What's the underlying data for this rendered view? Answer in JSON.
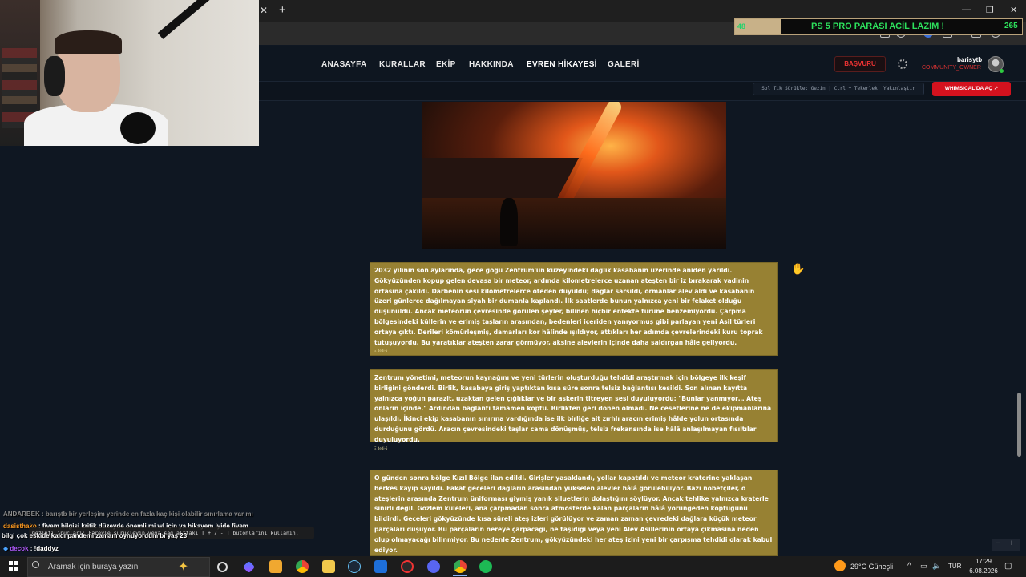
{
  "browser": {
    "tab_close": "✕",
    "tab_new": "+",
    "window_controls": [
      "—",
      "❐",
      "✕"
    ]
  },
  "donation_goal": {
    "current": "48",
    "title": "PS 5 PRO PARASI ACİL LAZIM !",
    "target": "265"
  },
  "nav": {
    "links": [
      "ANASAYFA",
      "KURALLAR",
      "EKİP",
      "HAKKINDA",
      "EVREN HİKAYESİ",
      "GALERİ"
    ],
    "apply_button": "BAŞVURU",
    "user_name": "barisytb",
    "user_role": "COMMUNITY_OWNER"
  },
  "toolbar": {
    "hint": "Sol Tık Sürükle: Gezin | Ctrl + Tekerlek: Yakınlaştır",
    "whimsical_button": "WHIMSICAL'DA AÇ"
  },
  "story": {
    "paragraph1": "2032 yılının son aylarında, gece göğü Zentrum'un kuzeyindeki dağlık kasabanın üzerinde aniden yarıldı. Gökyüzünden kopup gelen devasa bir meteor, ardında kilometrelerce uzanan ateşten bir iz bırakarak vadinin ortasına çakıldı. Darbenin sesi kilometrelerce öteden duyuldu; dağlar sarsıldı, ormanlar alev aldı ve kasabanın üzeri günlerce dağılmayan siyah bir dumanla kaplandı.  İlk saatlerde bunun yalnızca yeni bir felaket olduğu düşünüldü. Ancak meteorun çevresinde görülen şeyler, bilinen hiçbir enfekte türüne benzemiyordu. Çarpma bölgesindeki küllerin ve erimiş taşların arasından, bedenleri içeriden yanıyormuş gibi parlayan yeni Asil türleri ortaya çıktı. Derileri kömürleşmiş, damarları kor hâlinde ışıldıyor, attıkları her adımda çevrelerindeki kuru toprak tutuşuyordu. Bu yaratıklar ateşten zarar görmüyor, aksine alevlerin içinde daha saldırgan hâle geliyordu.",
    "paragraph2": "Zentrum yönetimi, meteorun kaynağını ve yeni türlerin oluşturduğu tehdidi araştırmak için bölgeye ilk keşif birliğini gönderdi. Birlik, kasabaya giriş yaptıktan kısa süre sonra telsiz bağlantısı kesildi. Son alınan kayıtta yalnızca yoğun parazit, uzaktan gelen çığlıklar ve bir askerin titreyen sesi duyuluyordu:  \"Bunlar yanmıyor… Ateş onların içinde.\"  Ardından bağlantı tamamen koptu.  Birlikten geri dönen olmadı. Ne cesetlerine ne de ekipmanlarına ulaşıldı. İkinci ekip kasabanın sınırına vardığında ise ilk birliğe ait zırhlı aracın erimiş hâlde yolun ortasında durduğunu gördü. Aracın çevresindeki taşlar cama dönüşmüş, telsiz frekansında ise hâlâ anlaşılmayan fısıltılar duyuluyordu.",
    "paragraph3_pre": "O günden sonra bölge ",
    "paragraph3_bold": "Kızıl Bölge",
    "paragraph3_post": " ilan edildi. Girişler yasaklandı, yollar kapatıldı ve meteor kraterine yaklaşan herkes kayıp sayıldı. Fakat geceleri dağların arasından yükselen alevler hâlâ görülebiliyor.  Bazı nöbetçiler, o ateşlerin arasında Zentrum üniforması giymiş yanık siluetlerin dolaştığını söylüyor.  Ancak tehlike yalnızca kraterle sınırlı değil. Gözlem kuleleri, ana çarpmadan sonra atmosferde kalan parçaların hâlâ yörüngeden koptuğunu bildirdi. Geceleri gökyüzünde kısa süreli ateş izleri görülüyor ve zaman zaman çevredeki dağlara küçük meteor parçaları düşüyor. Bu parçaların nereye çarpacağı, ne taşıdığı veya yeni Alev Asillerinin ortaya çıkmasına neden olup olmayacağı bilinmiyor. Bu nedenle Zentrum, gökyüzündeki her ateş izini yeni bir çarpışma tehdidi olarak kabul ediyor.",
    "card_tag": "Ξ dedi-5"
  },
  "chat": [
    {
      "user": "ANDARBEK",
      "sep": " : ",
      "text": "barıştb bir yerleşim yerinde en fazla kaç kişi olabilir sınırlama var mı",
      "faded": true
    },
    {
      "user": "dasisthako",
      "sep": " : ",
      "text": "fivem bilgisi kritik düzeyde önemli mi wl için ya hikayem iyide fivem"
    },
    {
      "user": "",
      "sep": "",
      "text": "bilgi çok eskide kaldı pandemi zamanı oynuyordum bi yaş 23"
    },
    {
      "user": "decok",
      "sep": " : ",
      "text": "!daddyz"
    }
  ],
  "toast": "Gezinti ipuçları: Fareyle sürükleyin veya sağ alttaki [ + / - ] butonlarını kullanın.",
  "zoom": {
    "minus": "−",
    "plus": "+"
  },
  "taskbar": {
    "search_placeholder": "Aramak için buraya yazın",
    "weather": "29°C  Güneşli",
    "lang": "TUR",
    "time": "17:29",
    "date": "6.08.2026"
  },
  "colors": {
    "card_bg": "#978133",
    "accent_red": "#d4121e",
    "goal_green": "#2de05c"
  }
}
